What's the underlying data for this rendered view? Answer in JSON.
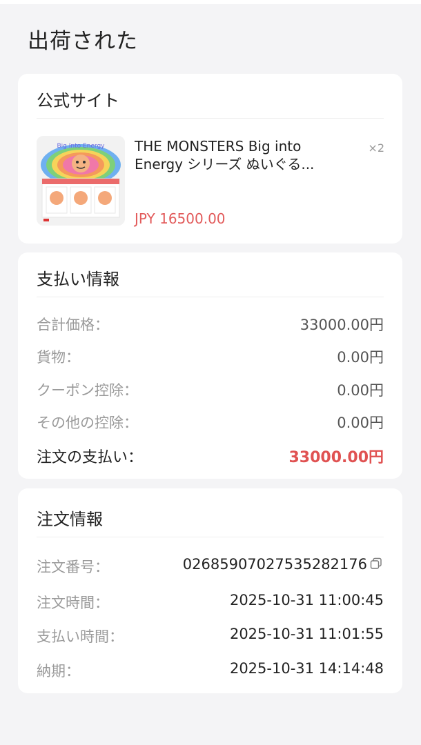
{
  "page": {
    "title": "出荷された"
  },
  "store": {
    "title": "公式サイト",
    "product": {
      "name": "THE MONSTERS Big into Energy シリーズ ぬいぐる...",
      "qty": "×2",
      "price": "JPY 16500.00"
    }
  },
  "payment": {
    "title": "支払い情報",
    "rows": [
      {
        "label": "合計価格：",
        "value": "33000.00円"
      },
      {
        "label": "貨物：",
        "value": "0.00円"
      },
      {
        "label": "クーポン控除：",
        "value": "0.00円"
      },
      {
        "label": "その他の控除：",
        "value": "0.00円"
      }
    ],
    "total": {
      "label": "注文の支払い：",
      "value": "33000.00円"
    }
  },
  "order": {
    "title": "注文情報",
    "rows": [
      {
        "label": "注文番号：",
        "value": "026859070275352821​76"
      },
      {
        "label": "注文時間：",
        "value": "2025-10-31 11:00:45"
      },
      {
        "label": "支払い時間：",
        "value": "2025-10-31 11:01:55"
      },
      {
        "label": "納期：",
        "value": "2025-10-31 14:14:48"
      }
    ]
  },
  "colors": {
    "accent": "#e05252",
    "background": "#f4f4f6",
    "card": "#ffffff"
  },
  "icons": {
    "copy": "copy-icon"
  }
}
